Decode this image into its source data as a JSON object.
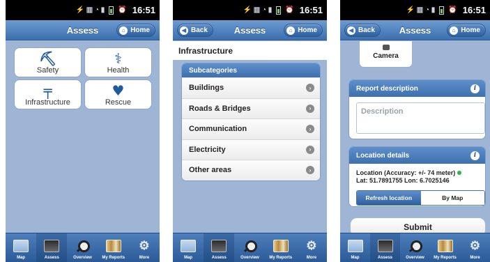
{
  "status": {
    "time": "16:51"
  },
  "screens": [
    {
      "header": {
        "title": "Assess",
        "home_label": "Home"
      },
      "categories": [
        {
          "label": "Safety",
          "icon": "person-icon"
        },
        {
          "label": "Health",
          "icon": "caduceus-icon"
        },
        {
          "label": "Infrastructure",
          "icon": "tower-icon"
        },
        {
          "label": "Rescue",
          "icon": "hands-icon"
        }
      ]
    },
    {
      "header": {
        "title": "Assess",
        "back_label": "Back",
        "home_label": "Home"
      },
      "page_title": "Infrastructure",
      "subcategories_title": "Subcategories",
      "subcategories": [
        "Buildings",
        "Roads & Bridges",
        "Communication",
        "Electricity",
        "Other areas"
      ]
    },
    {
      "header": {
        "title": "Assess",
        "back_label": "Back",
        "home_label": "Home"
      },
      "camera_label": "Camera",
      "report_description_title": "Report description",
      "description_placeholder": "Description",
      "location_title": "Location details",
      "location_accuracy": "Location (Accuracy: +/- 74 meter)",
      "location_coords": "Lat: 51.7891755 Lon: 6.7025146",
      "refresh_label": "Refresh location",
      "by_map_label": "By Map",
      "submit_label": "Submit"
    }
  ],
  "tabbar": [
    {
      "label": "Map",
      "icon": "map-icon"
    },
    {
      "label": "Assess",
      "icon": "assess-icon"
    },
    {
      "label": "Overview",
      "icon": "magnifier-icon"
    },
    {
      "label": "My Reports",
      "icon": "reports-icon"
    },
    {
      "label": "More",
      "icon": "gear-icon"
    }
  ],
  "colors": {
    "accent": "#3e70af",
    "background": "#9fb5d6",
    "online": "#2fb24c"
  }
}
